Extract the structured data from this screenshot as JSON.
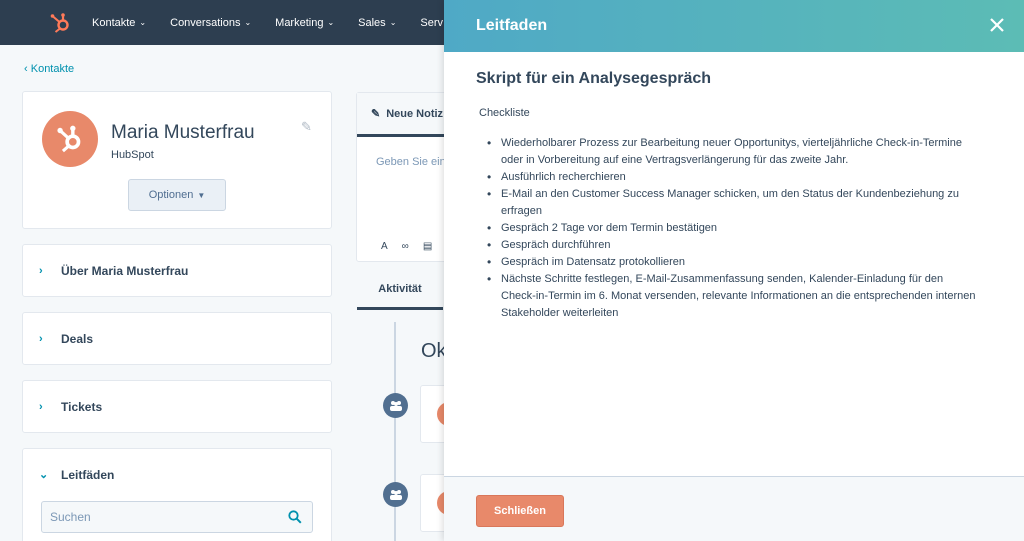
{
  "topnav": {
    "items": [
      {
        "label": "Kontakte"
      },
      {
        "label": "Conversations"
      },
      {
        "label": "Marketing"
      },
      {
        "label": "Sales"
      },
      {
        "label": "Serv"
      }
    ]
  },
  "breadcrumb": {
    "label": "Kontakte"
  },
  "profile": {
    "name": "Maria Musterfrau",
    "company": "HubSpot",
    "options_label": "Optionen"
  },
  "sections": [
    {
      "label": "Über Maria Musterfrau",
      "expanded": false
    },
    {
      "label": "Deals",
      "expanded": false
    },
    {
      "label": "Tickets",
      "expanded": false
    },
    {
      "label": "Leitfäden",
      "expanded": true
    }
  ],
  "search": {
    "placeholder": "Suchen"
  },
  "note": {
    "tab_label": "Neue Notiz",
    "placeholder": "Geben Sie ein"
  },
  "activity": {
    "tab_label": "Aktivität",
    "month_heading": "Ok"
  },
  "drawer": {
    "title": "Leitfaden",
    "script_title": "Skript für ein Analysegespräch",
    "checklist_label": "Checkliste",
    "items": [
      "Wiederholbarer Prozess zur Bearbeitung neuer Opportunitys, vierteljährliche Check-in-Termine oder in Vorbereitung auf eine Vertragsverlängerung für das zweite Jahr.",
      "Ausführlich recherchieren",
      "E-Mail an den Customer Success Manager schicken, um den Status der Kundenbeziehung zu erfragen",
      "Gespräch 2 Tage vor dem Termin bestätigen",
      "Gespräch durchführen",
      "Gespräch im Datensatz protokollieren",
      "Nächste Schritte festlegen, E-Mail-Zusammenfassung senden, Kalender-Einladung für den Check-in-Termin im 6. Monat versenden, relevante Informationen an die entsprechenden internen Stakeholder weiterleiten"
    ],
    "close_button": "Schließen"
  },
  "colors": {
    "nav_bg": "#2d3e50",
    "accent_orange": "#e8896a",
    "link_teal": "#0091ae",
    "drawer_header_start": "#4fa9c6",
    "drawer_header_end": "#5cbcb5"
  },
  "icons": [
    "hubspot-logo-icon",
    "chevron-left-icon",
    "pencil-icon",
    "caret-down-icon",
    "chevron-right-icon",
    "chevron-down-icon",
    "search-icon",
    "edit-note-icon",
    "close-icon",
    "people-icon"
  ]
}
